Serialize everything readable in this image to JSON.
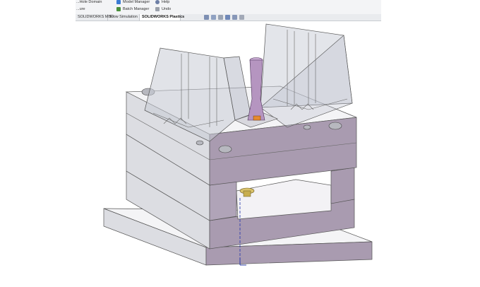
{
  "ribbon": {
    "left_items": [
      "...Hole Domain",
      "...ure"
    ],
    "model_manager_label": "Model Manager",
    "batch_manager_label": "Batch Manager",
    "help_label": "Help",
    "undo_label": "Undo"
  },
  "tabs": [
    {
      "label": "SOLIDWORKS MBD",
      "active": false
    },
    {
      "label": "Flow Simulation",
      "active": false
    },
    {
      "label": "SOLIDWORKS Plastics",
      "active": true
    }
  ],
  "heads_up_toolbar": [
    "zoom-to-fit-icon",
    "zoom-area-icon",
    "previous-view-icon",
    "section-view-icon",
    "view-orientation-icon",
    "display-style-icon"
  ],
  "viewport": {
    "model_description": "injection mold assembly",
    "colors": {
      "plate_front": "#dcdde2",
      "plate_side": "#a99bb0",
      "plate_top": "#f4f4f6",
      "transparent_block": "#c8ccd6",
      "sprue": "#b595c0",
      "gate": "#e58a2e",
      "ejector": "#d9c26a"
    }
  }
}
